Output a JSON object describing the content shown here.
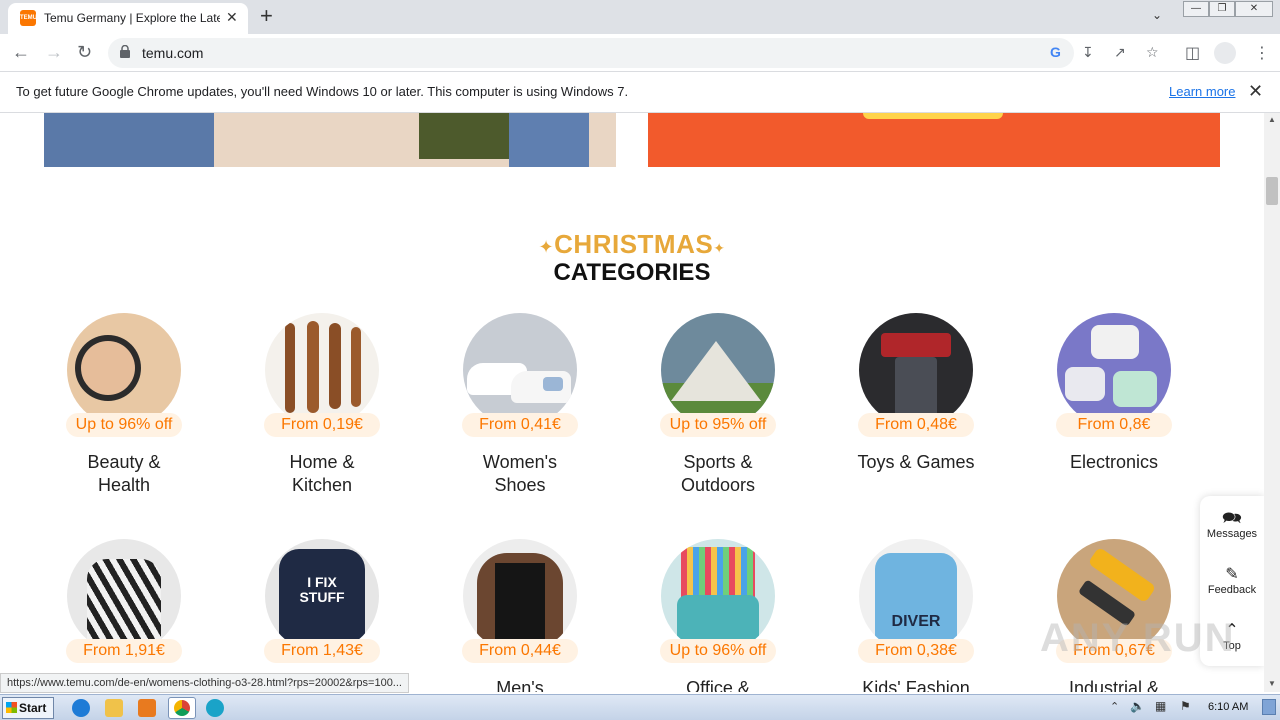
{
  "browser": {
    "tab_title": "Temu Germany | Explore the Latest C",
    "favicon_text": "TEMU",
    "url": "temu.com",
    "new_tab": "+",
    "close": "✕"
  },
  "infobar": {
    "message": "To get future Google Chrome updates, you'll need Windows 10 or later. This computer is using Windows 7.",
    "learn_more": "Learn more"
  },
  "section": {
    "title_line1": "CHRISTMAS",
    "title_line2": "CATEGORIES"
  },
  "categories": [
    {
      "badge": "Up to 96% off",
      "name_line1": "Beauty &",
      "name_line2": "Health"
    },
    {
      "badge": "From 0,19€",
      "name_line1": "Home &",
      "name_line2": "Kitchen"
    },
    {
      "badge": "From 0,41€",
      "name_line1": "Women's",
      "name_line2": "Shoes"
    },
    {
      "badge": "Up to 95% off",
      "name_line1": "Sports &",
      "name_line2": "Outdoors"
    },
    {
      "badge": "From 0,48€",
      "name_line1": "Toys & Games",
      "name_line2": ""
    },
    {
      "badge": "From 0,8€",
      "name_line1": "Electronics",
      "name_line2": ""
    },
    {
      "badge": "From 1,91€",
      "name_line1": "",
      "name_line2": ""
    },
    {
      "badge": "From 1,43€",
      "name_line1": "",
      "name_line2": ""
    },
    {
      "badge": "From 0,44€",
      "name_line1": "Men's",
      "name_line2": ""
    },
    {
      "badge": "Up to 96% off",
      "name_line1": "Office &",
      "name_line2": ""
    },
    {
      "badge": "From 0,38€",
      "name_line1": "Kids' Fashion",
      "name_line2": ""
    },
    {
      "badge": "From 0,67€",
      "name_line1": "Industrial &",
      "name_line2": ""
    }
  ],
  "tshirt_text": {
    "line1": "I FIX",
    "line2": "STUFF"
  },
  "kids_text": "DIVER",
  "side_panel": {
    "messages": "Messages",
    "feedback": "Feedback",
    "top": "Top"
  },
  "status_url": "https://www.temu.com/de-en/womens-clothing-o3-28.html?rps=20002&rps=100...",
  "watermark": "ANY RUN",
  "taskbar": {
    "start": "Start",
    "clock": "6:10 AM"
  },
  "colors": {
    "accent": "#fb7701",
    "heading_gold": "#e7a83a"
  }
}
